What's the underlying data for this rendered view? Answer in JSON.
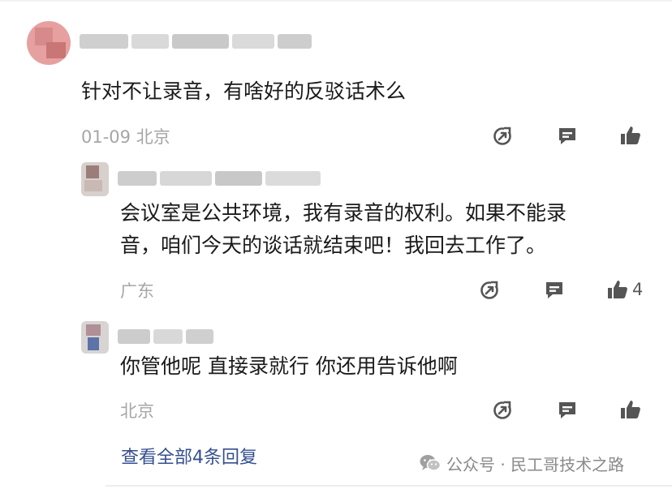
{
  "main_comment": {
    "text": "针对不让录音，有啥好的反驳话术么",
    "date": "01-09",
    "location": "北京"
  },
  "replies": [
    {
      "text_line1": "会议室是公共环境，我有录音的权利。如果不能录",
      "text_line2": "音，咱们今天的谈话就结束吧！我回去工作了。",
      "location": "广东",
      "like_count": "4"
    },
    {
      "text": "你管他呢 直接录就行 你还用告诉他啊",
      "location": "北京"
    }
  ],
  "view_all_label": "查看全部4条回复",
  "watermark": "公众号 · 民工哥技术之路",
  "icons": [
    "share-icon",
    "comment-icon",
    "like-icon",
    "wechat-icon"
  ],
  "colors": {
    "text": "#1a1a1a",
    "meta": "#a6a6a6",
    "icon": "#555555",
    "link": "#35508f"
  }
}
